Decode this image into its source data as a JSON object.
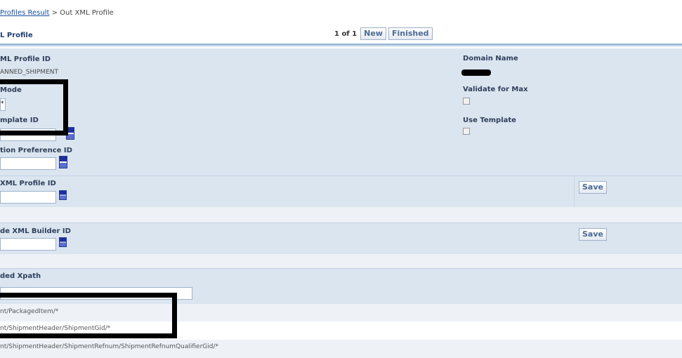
{
  "breadcrumb": {
    "link": "Profiles Result",
    "separator": ">",
    "current": "Out XML Profile"
  },
  "page": {
    "title": "L Profile"
  },
  "pager": {
    "count": "1 of 1",
    "new_label": "New",
    "finished_label": "Finished"
  },
  "form": {
    "xml_profile_id_label": "ML Profile ID",
    "xml_profile_id_value": "ANNED_SHIPMENT",
    "mode_label": "Mode",
    "mode_value": "*",
    "template_id_label": "mplate ID",
    "option_pref_label": "tion Preference ID",
    "domain_name_label": "Domain Name",
    "validate_max_label": "Validate for Max",
    "use_template_label": "Use Template"
  },
  "sections": {
    "xml_profile": {
      "label": "XML Profile ID",
      "save_label": "Save"
    },
    "xml_builder": {
      "label": "de XML Builder ID",
      "save_label": "Save"
    },
    "xpath": {
      "label": "ded Xpath"
    }
  },
  "xpath_rows": [
    "nt/PackagedItem/*",
    "nt/ShipmentHeader/ShipmentGid/*",
    "nt/ShipmentHeader/ShipmentRefnum/ShipmentRefnumQualifierGid/*"
  ],
  "colors": {
    "panel": "#dbe5f0",
    "band": "#dbe5f0",
    "rule": "#9dbad9",
    "link": "#1a4fa3"
  },
  "icons": {
    "lookup": "lookup-icon",
    "checkbox": "checkbox-icon"
  }
}
